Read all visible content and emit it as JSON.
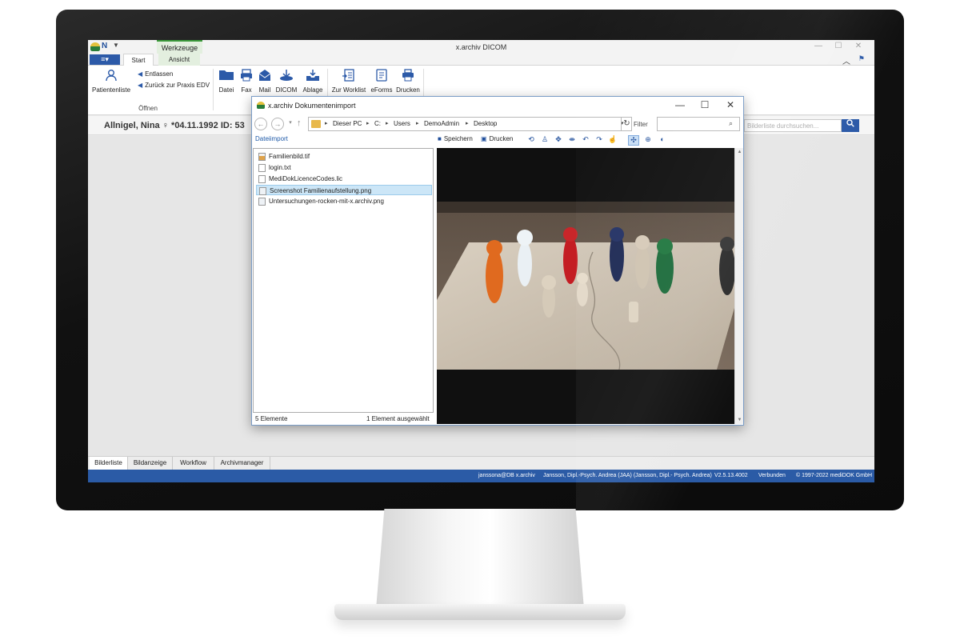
{
  "app": {
    "window_title": "x.archiv DICOM",
    "quick_access": {
      "logo_icon": "medidok-logo-icon",
      "qa_icon": "x-archiv-icon",
      "dropdown_icon": "chevron-down-icon"
    },
    "contextual_tab": "Werkzeuge",
    "menu_button": "≡▾",
    "tabs": [
      {
        "label": "Start"
      },
      {
        "label": "Ansicht"
      }
    ],
    "window_controls": {
      "minimize": "—",
      "maximize": "☐",
      "close": "✕"
    }
  },
  "ribbon": {
    "patientenliste": {
      "label": "Patientenliste",
      "icon": "person-icon"
    },
    "entlassen": {
      "label": "Entlassen",
      "icon": "discharge-icon"
    },
    "zurueck": {
      "label": "Zurück zur Praxis EDV",
      "icon": "back-icon"
    },
    "group_oeffnen": "Öffnen",
    "buttons": [
      {
        "label": "Datei",
        "icon": "folder-icon"
      },
      {
        "label": "Fax",
        "icon": "fax-icon"
      },
      {
        "label": "Mail",
        "icon": "mail-icon"
      },
      {
        "label": "DICOM",
        "icon": "dicom-icon"
      },
      {
        "label": "Ablage",
        "icon": "tray-icon"
      },
      {
        "label": "Zur Worklist",
        "icon": "worklist-icon"
      },
      {
        "label": "eForms",
        "icon": "eforms-icon"
      },
      {
        "label": "Drucken",
        "icon": "printer-icon"
      }
    ]
  },
  "patient": {
    "header": "Allnigel, Nina  ♀  *04.11.1992  ID: 53",
    "search_placeholder": "Bilderliste durchsuchen..."
  },
  "dialog": {
    "title": "x.archiv Dokumentenimport",
    "breadcrumbs": [
      "Dieser PC",
      "C:",
      "Users",
      "DemoAdmin",
      "Desktop"
    ],
    "filter_label": "Filter",
    "filter_value": "",
    "section_title": "Dateiimport",
    "save_label": "Speichern",
    "print_label": "Drucken",
    "tool_icons": [
      "rotate-icon",
      "person-icon",
      "move-icon",
      "flip-icon",
      "undo-icon",
      "redo-icon",
      "pointer-icon",
      "pan-icon",
      "zoom-icon",
      "contrast-icon"
    ],
    "files": [
      {
        "name": "Familienbild.tif",
        "type": "img"
      },
      {
        "name": "login.txt",
        "type": "txt"
      },
      {
        "name": "MediDokLicenceCodes.lic",
        "type": "txt"
      },
      {
        "name": "Screenshot Familienaufstellung.png",
        "type": "png",
        "selected": true
      },
      {
        "name": "Untersuchungen-rocken-mit-x.archiv.png",
        "type": "png"
      }
    ],
    "status_count": "5 Elemente",
    "status_selected": "1 Element ausgewählt"
  },
  "bottom_tabs": [
    "Bilderliste",
    "Bildanzeige",
    "Workflow",
    "Archivmanager"
  ],
  "statusbar": {
    "user": "janssona@DB x.archiv",
    "doctor": "Jansson, Dipl.-Psych. Andrea (JAA) (Jansson, Dipl.- Psych. Andrea)",
    "version": "V2.5.13.4002",
    "connection": "Verbunden",
    "copyright": "© 1997-2022 mediDOK GmbH"
  },
  "colors": {
    "accent": "#2c5aa8",
    "status_bar": "#2b5ba6",
    "context_tab": "#3c9b3c"
  }
}
